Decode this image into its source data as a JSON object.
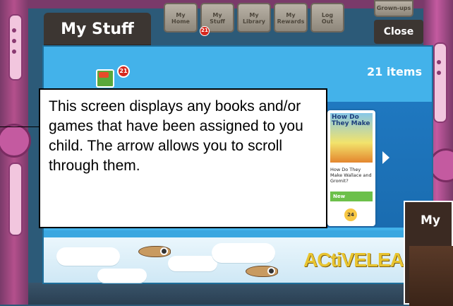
{
  "header": {
    "title": "My Stuff",
    "close_label": "Close"
  },
  "nav": [
    {
      "label": "My\nHome"
    },
    {
      "label": "My\nStuff"
    },
    {
      "label": "My\nLibrary"
    },
    {
      "label": "My\nRewards"
    },
    {
      "label": "Log\nOut"
    }
  ],
  "nav_badge": "21",
  "grownups_label": "Grown-ups",
  "panel": {
    "items_count": "21 items",
    "stuff_badge": "21"
  },
  "book": {
    "cover_title": "How Do They Make",
    "title": "How Do They Make Wallace and Gromit?",
    "status": "New",
    "points": "24"
  },
  "brand": "ACtiVELEAn",
  "callout_text": "This screen displays any books and/or games that have been assigned to you child.  The arrow allows you to scroll through them.",
  "popup_title": "My"
}
